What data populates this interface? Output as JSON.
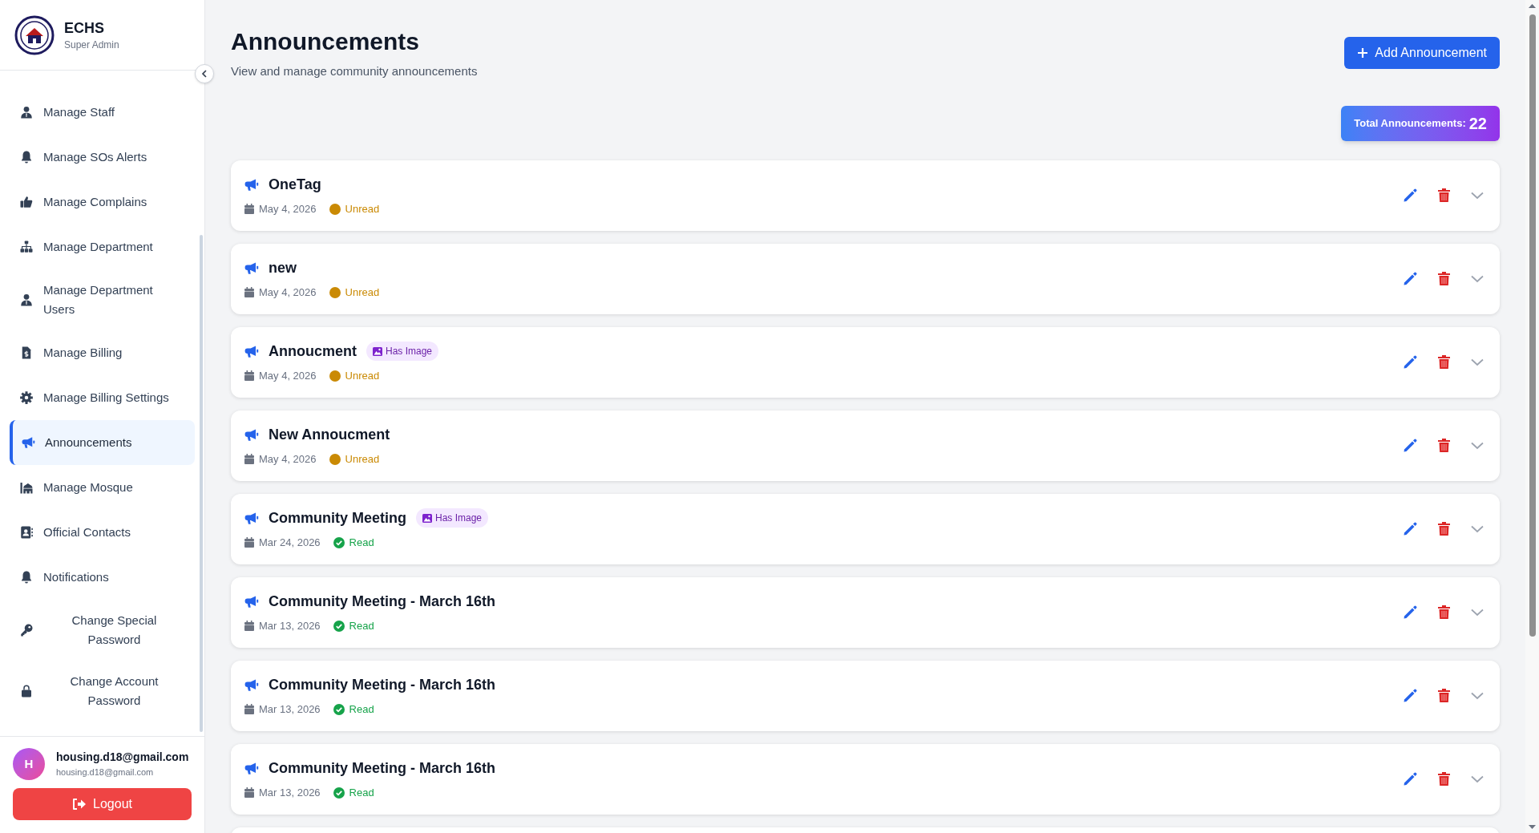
{
  "brand": {
    "name": "ECHS",
    "role": "Super Admin"
  },
  "sidebar": {
    "items": [
      {
        "label": "Manage Staff",
        "selected": false,
        "centered": false
      },
      {
        "label": "Manage SOs Alerts",
        "selected": false,
        "centered": false
      },
      {
        "label": "Manage Complains",
        "selected": false,
        "centered": false
      },
      {
        "label": "Manage Department",
        "selected": false,
        "centered": false
      },
      {
        "label": "Manage Department Users",
        "selected": false,
        "centered": false
      },
      {
        "label": "Manage Billing",
        "selected": false,
        "centered": false
      },
      {
        "label": "Manage Billing Settings",
        "selected": false,
        "centered": false
      },
      {
        "label": "Announcements",
        "selected": true,
        "centered": false
      },
      {
        "label": "Manage Mosque",
        "selected": false,
        "centered": false
      },
      {
        "label": "Official Contacts",
        "selected": false,
        "centered": false
      },
      {
        "label": "Notifications",
        "selected": false,
        "centered": false
      },
      {
        "label": "Change Special Password",
        "selected": false,
        "centered": true
      },
      {
        "label": "Change Account Password",
        "selected": false,
        "centered": true
      }
    ]
  },
  "user": {
    "initial": "H",
    "name": "housing.d18@gmail.com",
    "email": "housing.d18@gmail.com"
  },
  "logout": "Logout",
  "page": {
    "title": "Announcements",
    "subtitle": "View and manage community announcements"
  },
  "add_button": "Add Announcement",
  "total": {
    "label": "Total Announcements:",
    "count": "22"
  },
  "announcements": [
    {
      "title": "OneTag",
      "date": "May 4, 2026",
      "status": "Unread",
      "read": false
    },
    {
      "title": "new",
      "date": "May 4, 2026",
      "status": "Unread",
      "read": false
    },
    {
      "title": "Annoucment",
      "badge": "Has Image",
      "date": "May 4, 2026",
      "status": "Unread",
      "read": false
    },
    {
      "title": "New Annoucment",
      "date": "May 4, 2026",
      "status": "Unread",
      "read": false
    },
    {
      "title": "Community Meeting",
      "badge": "Has Image",
      "date": "Mar 24, 2026",
      "status": "Read",
      "read": true
    },
    {
      "title": "Community Meeting - March 16th",
      "date": "Mar 13, 2026",
      "status": "Read",
      "read": true
    },
    {
      "title": "Community Meeting - March 16th",
      "date": "Mar 13, 2026",
      "status": "Read",
      "read": true
    },
    {
      "title": "Community Meeting - March 16th",
      "date": "Mar 13, 2026",
      "status": "Read",
      "read": true
    }
  ]
}
